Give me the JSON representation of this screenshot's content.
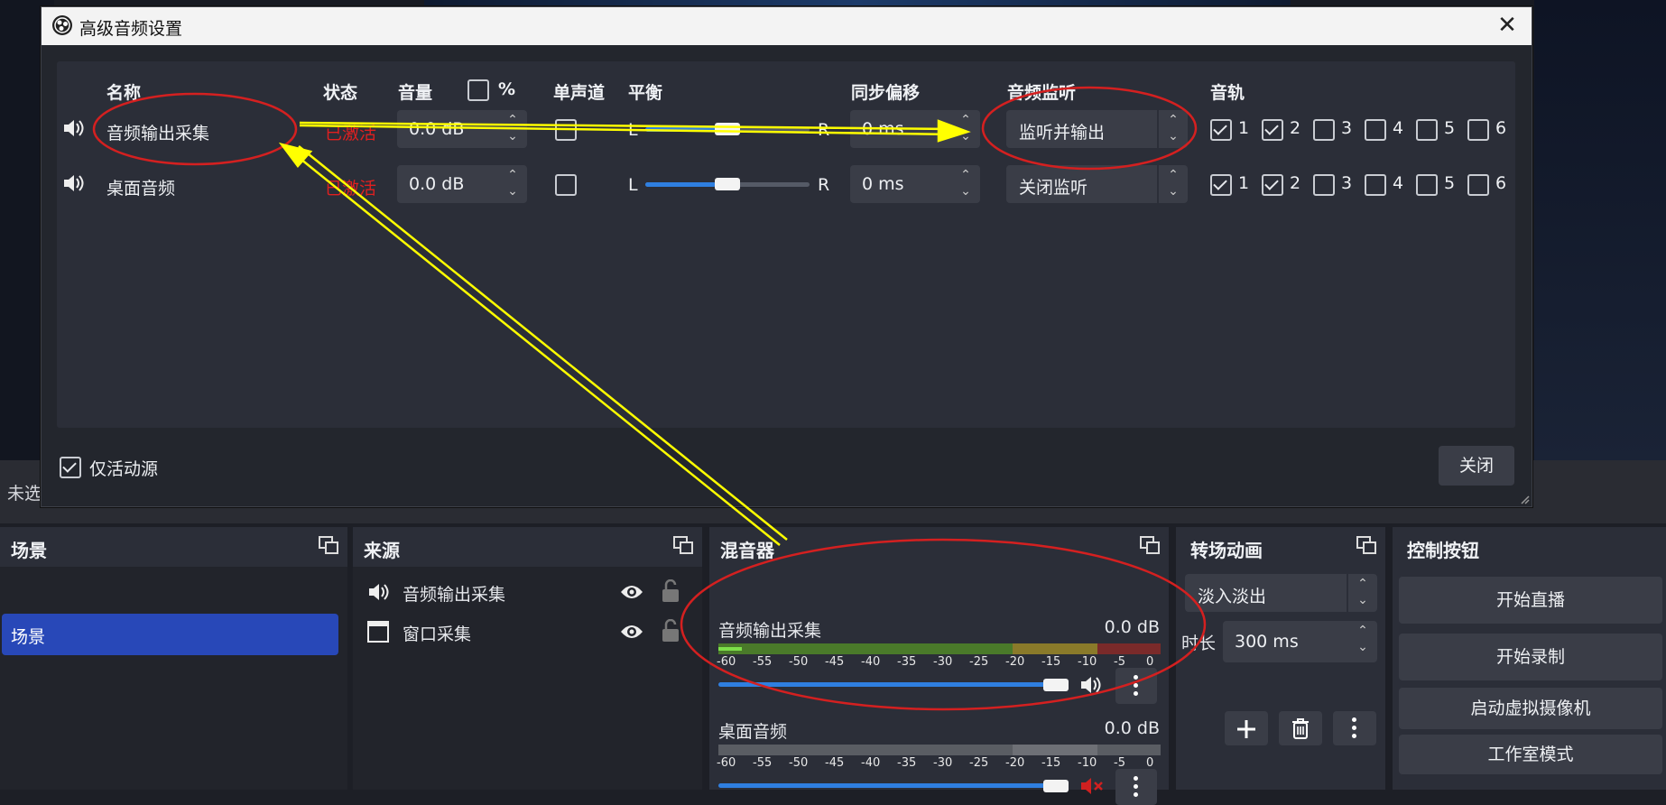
{
  "dialog": {
    "title": "高级音频设置",
    "close_label": "关闭",
    "active_only_label": "仅活动源",
    "active_only_checked": true,
    "headers": {
      "name": "名称",
      "status": "状态",
      "volume": "音量",
      "percent": "%",
      "mono": "单声道",
      "balance": "平衡",
      "sync_offset": "同步偏移",
      "monitoring": "音频监听",
      "tracks": "音轨"
    },
    "rows": [
      {
        "name": "音频输出采集",
        "status": "已激活",
        "volume": "0.0 dB",
        "mono": false,
        "balance_left": "L",
        "balance_right": "R",
        "sync_offset": "0 ms",
        "monitoring": "监听并输出",
        "tracks": [
          {
            "label": "1",
            "checked": true
          },
          {
            "label": "2",
            "checked": true
          },
          {
            "label": "3",
            "checked": false
          },
          {
            "label": "4",
            "checked": false
          },
          {
            "label": "5",
            "checked": false
          },
          {
            "label": "6",
            "checked": false
          }
        ]
      },
      {
        "name": "桌面音频",
        "status": "已激活",
        "volume": "0.0 dB",
        "mono": false,
        "balance_left": "L",
        "balance_right": "R",
        "sync_offset": "0 ms",
        "monitoring": "关闭监听",
        "tracks": [
          {
            "label": "1",
            "checked": true
          },
          {
            "label": "2",
            "checked": true
          },
          {
            "label": "3",
            "checked": false
          },
          {
            "label": "4",
            "checked": false
          },
          {
            "label": "5",
            "checked": false
          },
          {
            "label": "6",
            "checked": false
          }
        ]
      }
    ]
  },
  "status_bar": {
    "text": "未选"
  },
  "docks": {
    "scenes": {
      "title": "场景",
      "items": [
        "场景"
      ]
    },
    "sources": {
      "title": "来源",
      "items": [
        "音频输出采集",
        "窗口采集"
      ]
    },
    "mixer": {
      "title": "混音器",
      "scale": [
        "-60",
        "-55",
        "-50",
        "-45",
        "-40",
        "-35",
        "-30",
        "-25",
        "-20",
        "-15",
        "-10",
        "-5",
        "0"
      ],
      "channels": [
        {
          "name": "音频输出采集",
          "level": "0.0 dB",
          "volume": 1.0,
          "muted": false
        },
        {
          "name": "桌面音频",
          "level": "0.0 dB",
          "volume": 1.0,
          "muted": true
        }
      ]
    },
    "transitions": {
      "title": "转场动画",
      "transition": "淡入淡出",
      "duration_label": "时长",
      "duration": "300 ms"
    },
    "controls": {
      "title": "控制按钮",
      "buttons": [
        "开始直播",
        "开始录制",
        "启动虚拟摄像机",
        "工作室模式"
      ]
    }
  },
  "colors": {
    "annotation_yellow": "#ffff00",
    "annotation_red": "#e02020",
    "accent_blue": "#2f7fe0",
    "selected_scene": "#2848b8"
  }
}
